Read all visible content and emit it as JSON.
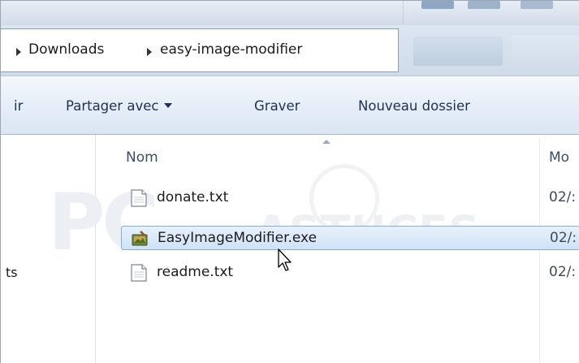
{
  "breadcrumb": [
    "Downloads",
    "easy-image-modifier"
  ],
  "toolbar": {
    "partial_left": "ir",
    "share_label": "Partager avec",
    "burn_label": "Graver",
    "new_folder_label": "Nouveau dossier"
  },
  "nav_pane": {
    "partial_item": "ts"
  },
  "columns": {
    "name": "Nom",
    "modified_partial": "Mo"
  },
  "files": [
    {
      "name": "donate.txt",
      "date": "02/:",
      "icon": "text-file-icon",
      "selected": false
    },
    {
      "name": "EasyImageModifier.exe",
      "date": "02/:",
      "icon": "app-exe-icon",
      "selected": true
    },
    {
      "name": "readme.txt",
      "date": "02/:",
      "icon": "text-file-icon",
      "selected": false
    }
  ],
  "watermark": {
    "left": "PC",
    "right": "ASTUCES"
  },
  "colors": {
    "selection_border": "#84acdd",
    "selection_fill": "#cfe2f7",
    "toolbar_text": "#1e3150"
  }
}
